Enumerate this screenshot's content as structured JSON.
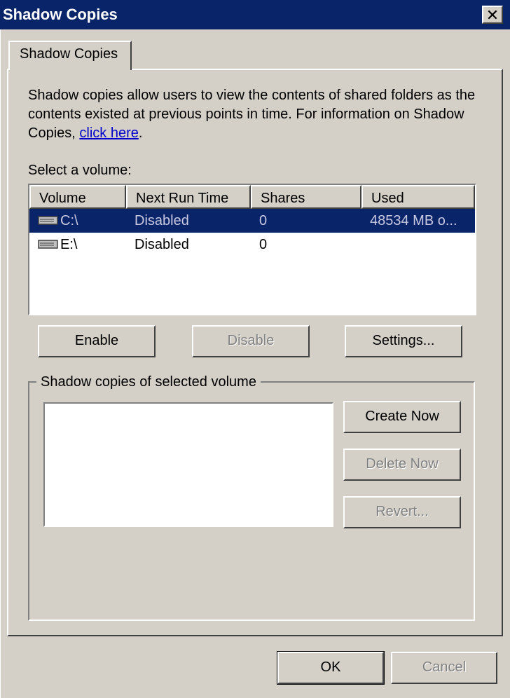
{
  "window": {
    "title": "Shadow Copies",
    "close_glyph": "✕"
  },
  "tab": {
    "label": "Shadow Copies"
  },
  "intro": {
    "text": "Shadow copies allow users to view the contents of shared folders as the contents existed at previous points in time. For information on Shadow Copies, ",
    "link": "click here",
    "after_link": "."
  },
  "volumes": {
    "label": "Select a volume:",
    "columns": [
      "Volume",
      "Next Run Time",
      "Shares",
      "Used"
    ],
    "rows": [
      {
        "volume": "C:\\",
        "next_run": "Disabled",
        "shares": "0",
        "used": "48534 MB o...",
        "selected": true,
        "icon": "drive-icon"
      },
      {
        "volume": "E:\\",
        "next_run": "Disabled",
        "shares": "0",
        "used": "",
        "selected": false,
        "icon": "drive-icon"
      }
    ]
  },
  "volume_buttons": {
    "enable": "Enable",
    "disable": "Disable",
    "settings": "Settings..."
  },
  "snapshots": {
    "group_label": "Shadow copies of selected volume",
    "create_now": "Create Now",
    "delete_now": "Delete Now",
    "revert": "Revert..."
  },
  "footer": {
    "ok": "OK",
    "cancel": "Cancel"
  },
  "colors": {
    "titlebar": "#0a246a",
    "face": "#d4d0c8",
    "selection": "#0a246a",
    "link": "#0000cc"
  }
}
